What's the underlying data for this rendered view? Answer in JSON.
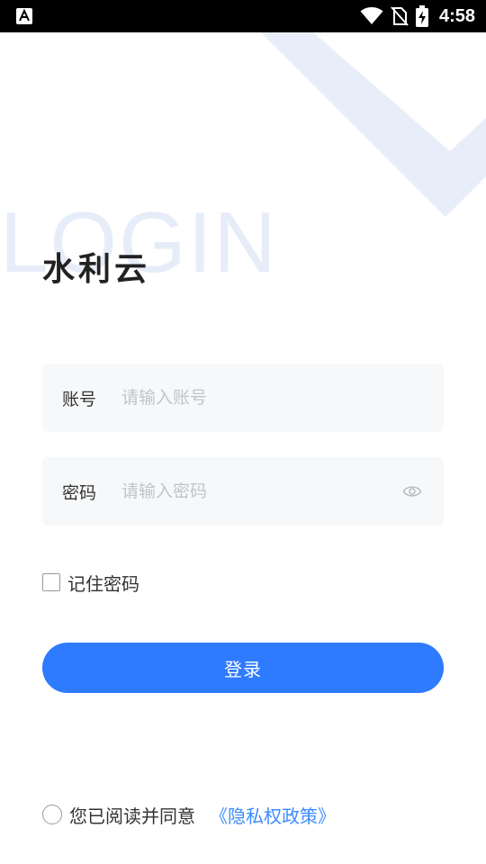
{
  "status_bar": {
    "time": "4:58",
    "icons": [
      "a-notification-icon",
      "wifi-icon",
      "no-sim-icon",
      "battery-charging-icon"
    ]
  },
  "background": {
    "watermark_text": "LOGIN",
    "accent_color": "#e6edf8"
  },
  "app": {
    "title": "水利云"
  },
  "account_field": {
    "label": "账号",
    "placeholder": "请输入账号",
    "value": ""
  },
  "password_field": {
    "label": "密码",
    "placeholder": "请输入密码",
    "value": "",
    "visibility_icon": "eye-icon"
  },
  "remember": {
    "label": "记住密码",
    "checked": false
  },
  "login_button": {
    "label": "登录",
    "color": "#2f7bff"
  },
  "agreement": {
    "text": "您已阅读并同意",
    "link_text": "《隐私权政策》",
    "link_color": "#3d8bff",
    "checked": false
  }
}
